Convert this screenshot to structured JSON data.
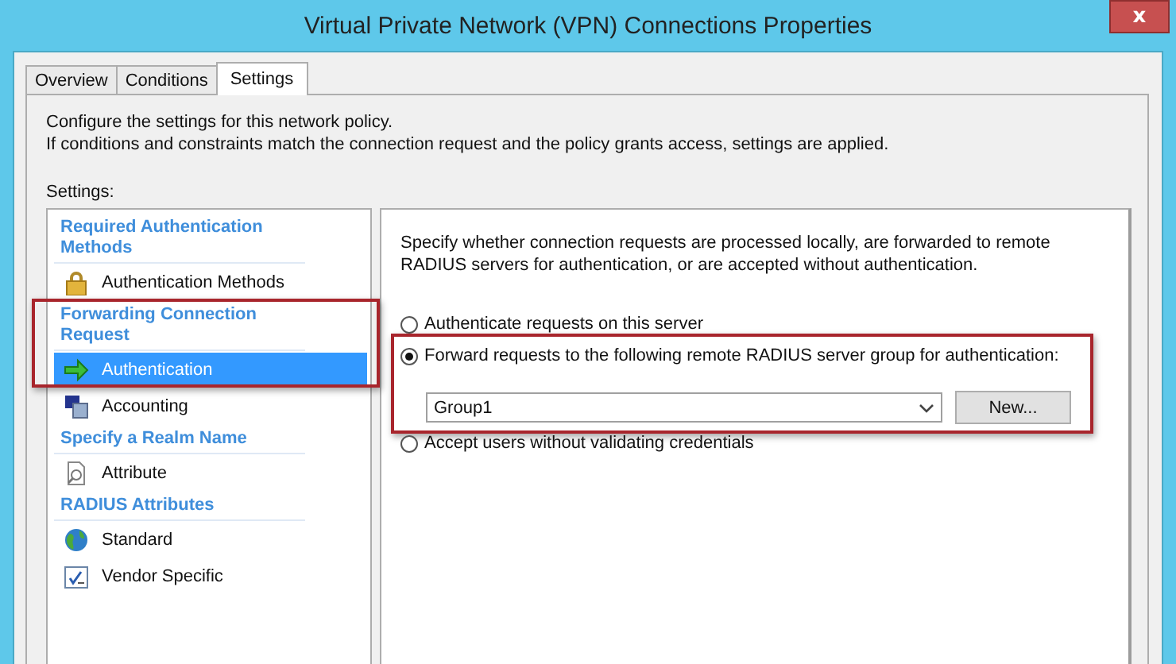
{
  "window": {
    "title": "Virtual Private Network (VPN) Connections Properties",
    "close": "x"
  },
  "tabs": [
    {
      "label": "Overview",
      "selected": false
    },
    {
      "label": "Conditions",
      "selected": false
    },
    {
      "label": "Settings",
      "selected": true
    }
  ],
  "intro": [
    "Configure the settings for this network policy.",
    "If conditions and constraints match the connection request and the policy grants access, settings are applied."
  ],
  "settings_label": "Settings:",
  "sidebar": {
    "groups": [
      {
        "heading": "Required Authentication Methods",
        "highlighted": false,
        "items": [
          {
            "label": "Authentication Methods",
            "kind": "lock",
            "selected": false
          }
        ]
      },
      {
        "heading": "Forwarding Connection Request",
        "highlighted": true,
        "items": [
          {
            "label": "Authentication",
            "kind": "arrow",
            "selected": true
          },
          {
            "label": "Accounting",
            "kind": "computer",
            "selected": false
          }
        ]
      },
      {
        "heading": "Specify a Realm Name",
        "highlighted": false,
        "items": [
          {
            "label": "Attribute",
            "kind": "document",
            "selected": false
          }
        ]
      },
      {
        "heading": "RADIUS Attributes",
        "highlighted": false,
        "items": [
          {
            "label": "Standard",
            "kind": "globe",
            "selected": false
          },
          {
            "label": "Vendor Specific",
            "kind": "check",
            "selected": false
          }
        ]
      }
    ]
  },
  "panel": {
    "description": "Specify whether connection requests are processed locally, are forwarded to remote RADIUS servers for authentication, or are accepted without authentication.",
    "options": [
      {
        "label": "Authenticate requests on this server",
        "selected": false,
        "highlighted": false
      },
      {
        "label": "Forward requests to the following remote RADIUS server group for authentication:",
        "selected": true,
        "highlighted": true,
        "server_group": {
          "value": "Group1",
          "button": "New..."
        }
      },
      {
        "label": "Accept users without validating credentials",
        "selected": false,
        "highlighted": false
      }
    ]
  }
}
